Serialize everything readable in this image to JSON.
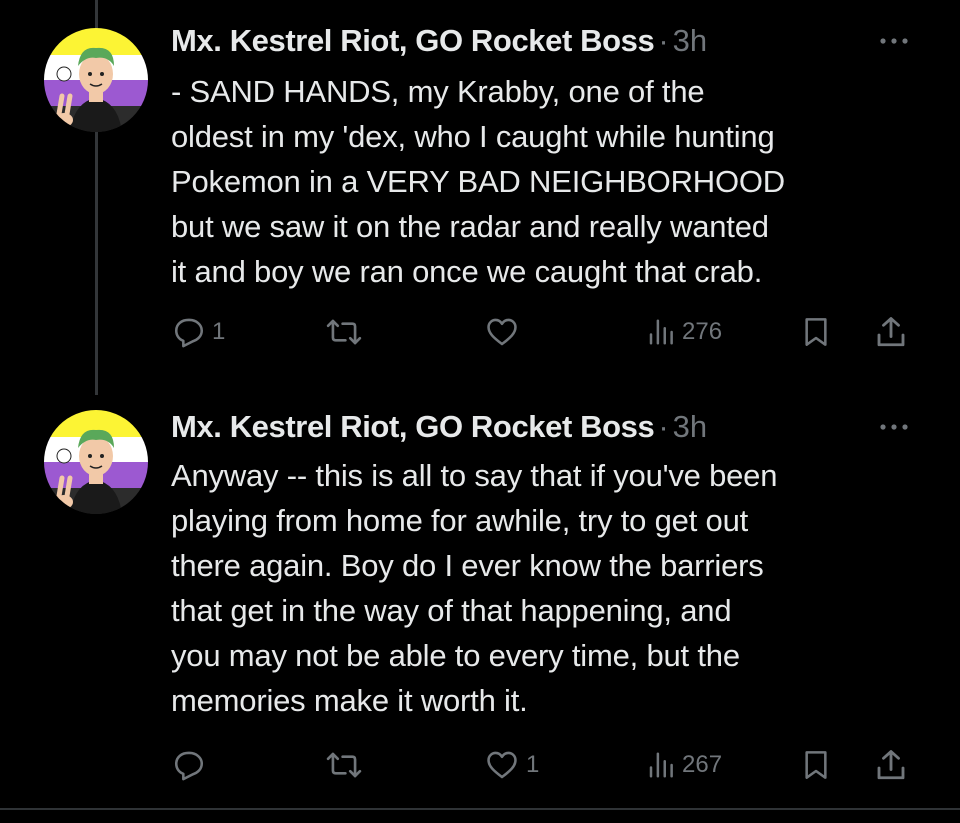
{
  "tweets": [
    {
      "author": "Mx. Kestrel Riot, GO Rocket Boss",
      "separator": "·",
      "time": "3h",
      "text": "- SAND HANDS, my Krabby, one of the\noldest in my 'dex, who I caught while hunting\nPokemon in a VERY BAD NEIGHBORHOOD\nbut we saw it on the radar and really wanted\nit and boy we ran once we caught that crab.",
      "replies": "1",
      "retweets": "",
      "likes": "",
      "views": "276"
    },
    {
      "author": "Mx. Kestrel Riot, GO Rocket Boss",
      "separator": "·",
      "time": "3h",
      "text": "Anyway -- this is all to say that if you've been\nplaying from home for awhile, try to get out\nthere again. Boy do I ever know the barriers\nthat get in the way of that happening, and\nyou may not be able to every time, but the\nmemories make it worth it.",
      "replies": "",
      "retweets": "",
      "likes": "1",
      "views": "267"
    }
  ],
  "colors": {
    "background": "#000000",
    "text": "#e7e9ea",
    "muted": "#71767b",
    "flag_yellow": "#fcf434",
    "flag_white": "#ffffff",
    "flag_purple": "#9c59d1",
    "flag_black": "#2c2c2c"
  },
  "icons": [
    "reply-icon",
    "retweet-icon",
    "like-icon",
    "views-icon",
    "bookmark-icon",
    "share-icon",
    "more-icon",
    "avatar"
  ]
}
